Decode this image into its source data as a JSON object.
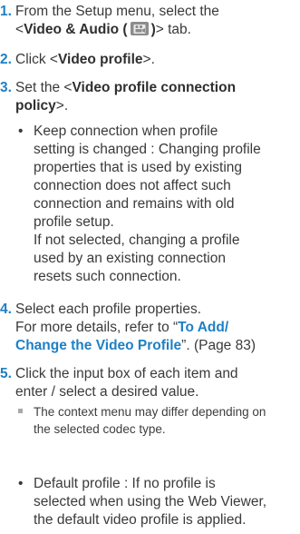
{
  "steps": {
    "s1": {
      "num": "1.",
      "l1": "From the Setup menu, select the",
      "l2_pre": "<",
      "l2_bold": "Video & Audio (",
      "l2_mid": ")",
      "l2_post": "> tab."
    },
    "s2": {
      "num": "2.",
      "pre": "Click <",
      "bold": "Video profile",
      "post": ">."
    },
    "s3": {
      "num": "3.",
      "pre": "Set the <",
      "bold1": "Video profile connection",
      "bold2": "policy",
      "post": ">."
    },
    "s3_bullet": {
      "dot": "•",
      "lines": [
        "Keep connection when profile",
        "setting is changed : Changing profile",
        "properties that is used by existing",
        "connection does not affect such",
        "connection and remains with old",
        "profile setup.",
        "If not selected, changing a profile",
        "used by an existing connection",
        "resets such connection."
      ]
    },
    "s4": {
      "num": "4.",
      "l1": "Select each profile properties.",
      "l2_pre": "For more details, refer to “",
      "l2_bold": "To Add/",
      "l3_bold": "Change the Video Profile",
      "l3_post": "”. (Page 83)"
    },
    "s5": {
      "num": "5.",
      "l1": "Click the input box of each item and",
      "l2": "enter / select a desired value."
    },
    "note": {
      "l1": "The context menu may differ depending on",
      "l2": "the selected codec type."
    },
    "s5_bullet": {
      "dot": "•",
      "lines": [
        "Default profile : If no profile is",
        "selected when using the Web Viewer,",
        "the default video profile is applied."
      ]
    }
  }
}
